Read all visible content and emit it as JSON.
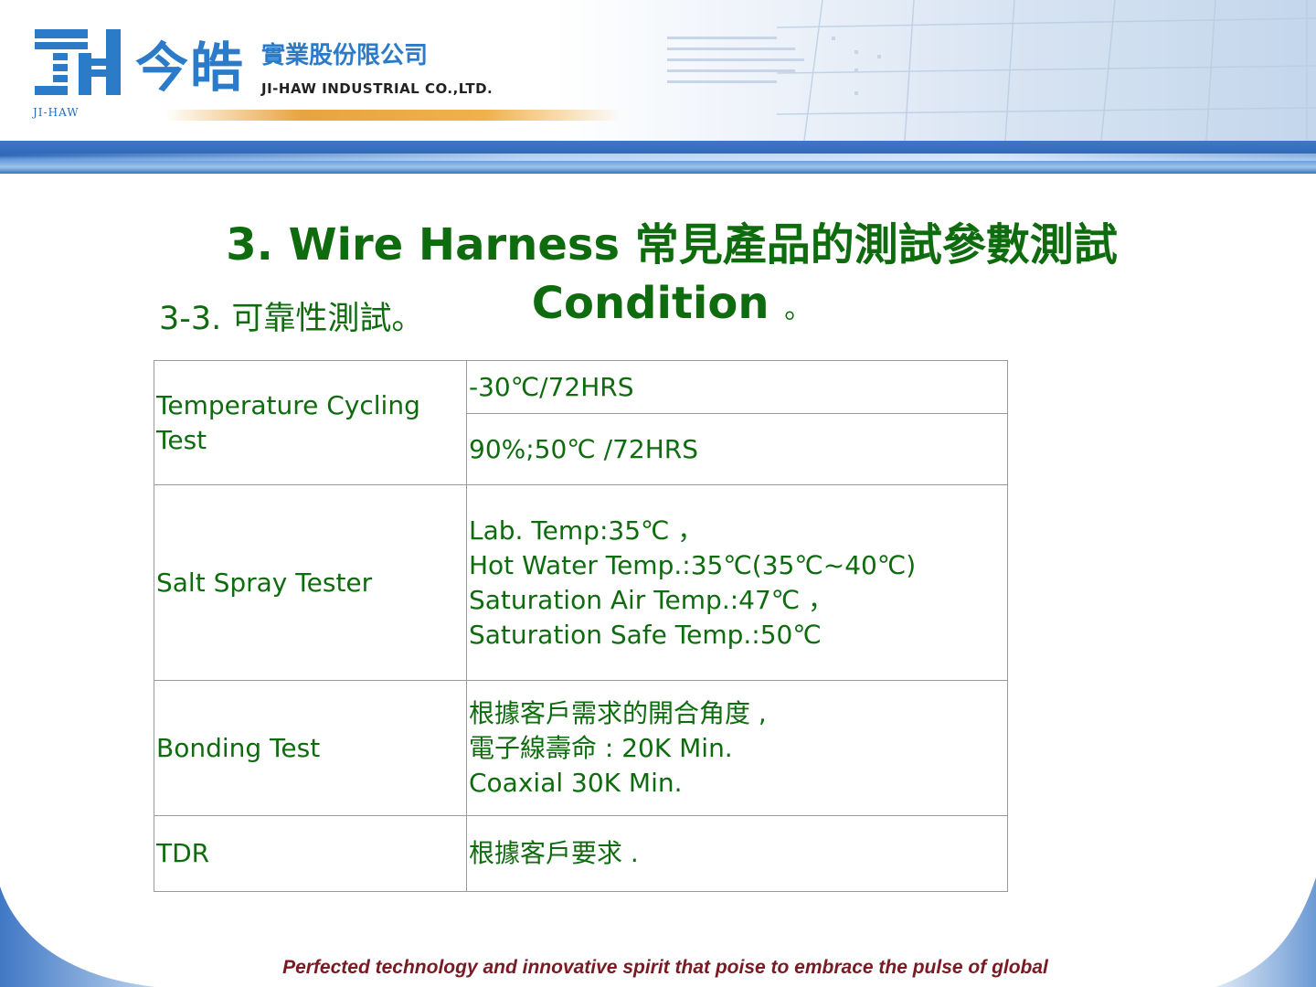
{
  "header": {
    "logo_mark_text": "JI-HAW",
    "company_name_cn_big": "今皓",
    "company_name_cn_small": "實業股份限公司",
    "company_name_en": "JI-HAW INDUSTRIAL CO.,LTD."
  },
  "title": {
    "line": "3. Wire Harness 常見產品的測試參數測試 Condition",
    "period": "。"
  },
  "subtitle": "3-3. 可靠性測試。",
  "table": {
    "rows": [
      {
        "test": "Temperature Cycling Test",
        "conditions": [
          "-30℃/72HRS",
          "90%;50℃ /72HRS"
        ]
      },
      {
        "test": "Salt Spray Tester",
        "lines": [
          "Lab. Temp:35℃ ，",
          "Hot Water Temp.:35℃(35℃~40℃)",
          "Saturation Air Temp.:47℃ ，",
          "Saturation Safe Temp.:50℃"
        ]
      },
      {
        "test": "Bonding Test",
        "lines": [
          "根據客戶需求的開合角度 ,",
          "電子線壽命 : 20K Min.",
          "Coaxial 30K Min."
        ]
      },
      {
        "test": "TDR",
        "lines": [
          "根據客戶要求 ."
        ]
      }
    ]
  },
  "footer": {
    "slogan": "Perfected technology and innovative spirit that poise to embrace the pulse of global"
  },
  "colors": {
    "title_green": "#0e6b0e",
    "brand_blue": "#2b7bc8",
    "footer_red": "#7a1a22"
  }
}
